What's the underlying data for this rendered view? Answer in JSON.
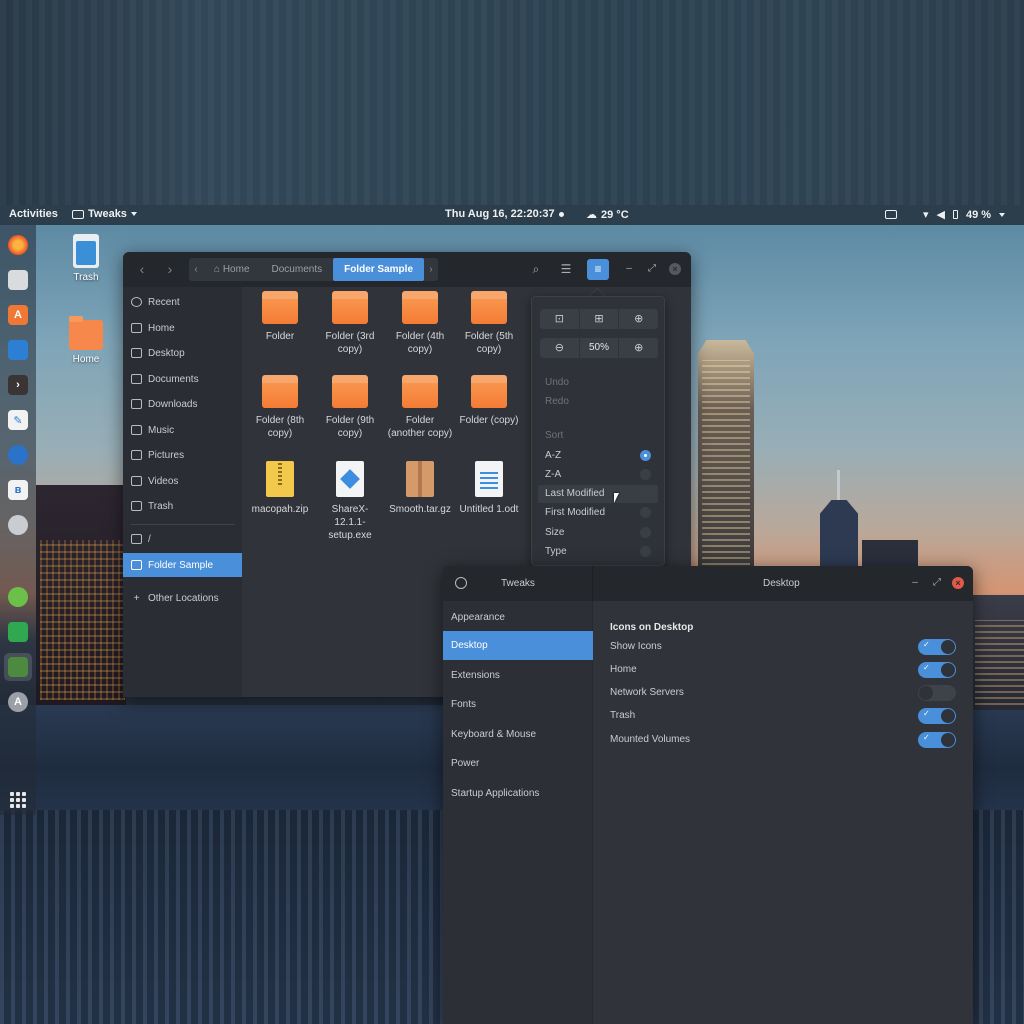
{
  "topbar": {
    "activities": "Activities",
    "app_name": "Tweaks",
    "clock": "Thu Aug 16, 22:20:37",
    "weather": "29 °C",
    "battery": "49 %"
  },
  "dock": {
    "items": [
      "firefox-icon",
      "files-icon",
      "software-icon",
      "writer-icon",
      "terminal-icon",
      "text-editor-icon",
      "thunderbird-icon",
      "bluetooth-icon",
      "settings-icon",
      "leaf-icon",
      "calc-icon",
      "tweaks-icon",
      "update-icon"
    ],
    "apps_grid": "show-applications-icon"
  },
  "desktop": {
    "trash_label": "Trash",
    "home_label": "Home"
  },
  "files": {
    "breadcrumb": [
      "Home",
      "Documents",
      "Folder Sample"
    ],
    "sidebar": [
      "Recent",
      "Home",
      "Desktop",
      "Documents",
      "Downloads",
      "Music",
      "Pictures",
      "Videos",
      "Trash",
      "/",
      "Folder Sample",
      "Other Locations"
    ],
    "items": [
      {
        "label": "Folder",
        "kind": "folder"
      },
      {
        "label": "Folder (3rd copy)",
        "kind": "folder"
      },
      {
        "label": "Folder (4th copy)",
        "kind": "folder"
      },
      {
        "label": "Folder (5th copy)",
        "kind": "folder"
      },
      {
        "label": "Folder (8th copy)",
        "kind": "folder"
      },
      {
        "label": "Folder (9th copy)",
        "kind": "folder"
      },
      {
        "label": "Folder (another copy)",
        "kind": "folder"
      },
      {
        "label": "Folder (copy)",
        "kind": "folder"
      },
      {
        "label": "macopah.zip",
        "kind": "zip"
      },
      {
        "label": "ShareX-12.1.1-setup.exe",
        "kind": "exe"
      },
      {
        "label": "Smooth.tar.gz",
        "kind": "tgz"
      },
      {
        "label": "Untitled 1.odt",
        "kind": "odt"
      }
    ]
  },
  "popover": {
    "zoom": "50%",
    "undo": "Undo",
    "redo": "Redo",
    "sort_heading": "Sort",
    "sort_options": [
      "A-Z",
      "Z-A",
      "Last Modified",
      "First Modified",
      "Size",
      "Type"
    ],
    "sort_selected": "A-Z"
  },
  "tweaks": {
    "window_title": "Tweaks",
    "page_title": "Desktop",
    "sidebar": [
      "Appearance",
      "Desktop",
      "Extensions",
      "Fonts",
      "Keyboard & Mouse",
      "Power",
      "Startup Applications"
    ],
    "active_item": "Desktop",
    "section": "Icons on Desktop",
    "settings": [
      {
        "label": "Show Icons",
        "on": true
      },
      {
        "label": "Home",
        "on": true
      },
      {
        "label": "Network Servers",
        "on": false
      },
      {
        "label": "Trash",
        "on": true
      },
      {
        "label": "Mounted Volumes",
        "on": true
      }
    ]
  },
  "colors": {
    "accent": "#4a8fd9",
    "folder": "#f47c35",
    "close_button": "#e05a45"
  }
}
